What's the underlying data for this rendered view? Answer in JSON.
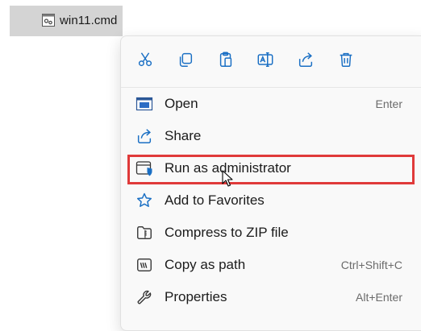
{
  "file": {
    "name": "win11.cmd",
    "icon": "cmd-file-icon"
  },
  "toolbar": [
    {
      "name": "cut-icon"
    },
    {
      "name": "copy-icon"
    },
    {
      "name": "paste-icon"
    },
    {
      "name": "rename-icon"
    },
    {
      "name": "share-icon"
    },
    {
      "name": "delete-icon"
    }
  ],
  "menu": {
    "items": [
      {
        "label": "Open",
        "shortcut": "Enter",
        "icon": "open-window-icon"
      },
      {
        "label": "Share",
        "shortcut": "",
        "icon": "share-icon"
      },
      {
        "label": "Run as administrator",
        "shortcut": "",
        "icon": "shield-window-icon"
      },
      {
        "label": "Add to Favorites",
        "shortcut": "",
        "icon": "star-icon"
      },
      {
        "label": "Compress to ZIP file",
        "shortcut": "",
        "icon": "zip-folder-icon"
      },
      {
        "label": "Copy as path",
        "shortcut": "Ctrl+Shift+C",
        "icon": "copy-path-icon"
      },
      {
        "label": "Properties",
        "shortcut": "Alt+Enter",
        "icon": "wrench-icon"
      }
    ]
  },
  "colors": {
    "accent": "#1a6fc4",
    "highlight_border": "#e03a3a",
    "menu_background": "#f9f9f9",
    "selected_file_background": "#d4d4d4"
  }
}
